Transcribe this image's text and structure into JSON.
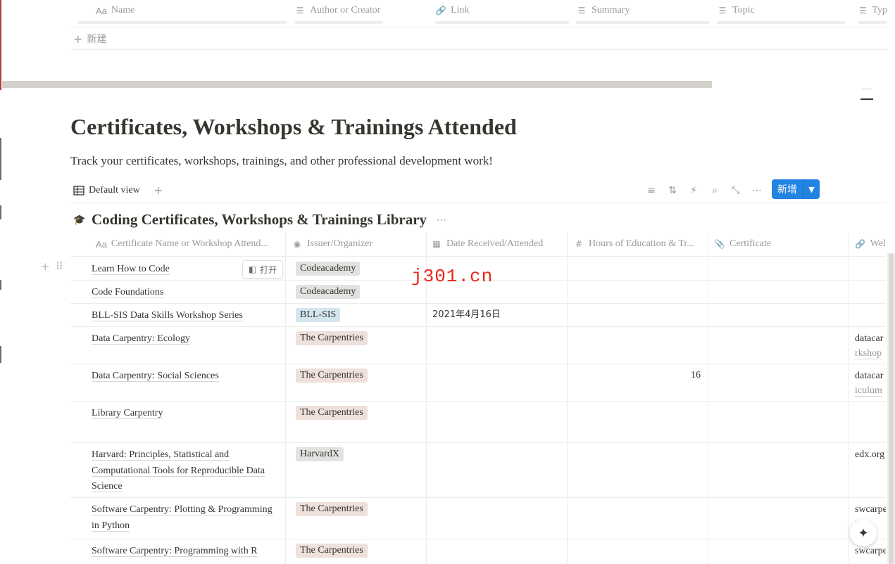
{
  "top_table": {
    "columns": [
      {
        "icon": "text-icon",
        "glyph": "Aa",
        "label": "Name"
      },
      {
        "icon": "list-icon",
        "glyph": "☰",
        "label": "Author or Creator"
      },
      {
        "icon": "link-icon",
        "glyph": "🔗",
        "label": "Link"
      },
      {
        "icon": "list-icon",
        "glyph": "☰",
        "label": "Summary"
      },
      {
        "icon": "list-icon",
        "glyph": "☰",
        "label": "Topic"
      },
      {
        "icon": "list-icon",
        "glyph": "☰",
        "label": "Typ"
      }
    ],
    "new_label": "新建"
  },
  "page": {
    "title": "Certificates, Workshops & Trainings Attended",
    "description": "Track your certificates, workshops, trainings, and other professional development work!"
  },
  "view_bar": {
    "view_label": "Default view",
    "add_glyph": "+",
    "tools": [
      "filter-icon",
      "sort-icon",
      "automation-icon",
      "search-icon",
      "expand-icon",
      "more-icon"
    ],
    "tool_glyphs": [
      "≡",
      "⇅",
      "⚡",
      "⌕",
      "⤡",
      "⋯"
    ],
    "new_button": "新增"
  },
  "database": {
    "icon_glyph": "🎓",
    "title": "Coding Certificates, Workshops & Trainings Library",
    "more_glyph": "⋯"
  },
  "columns": [
    {
      "icon": "text-icon",
      "glyph": "Aa",
      "label": "Certificate Name or Workshop Attend..."
    },
    {
      "icon": "select-icon",
      "glyph": "◉",
      "label": "Issuer/Organizer"
    },
    {
      "icon": "calendar-icon",
      "glyph": "▦",
      "label": "Date Received/Attended"
    },
    {
      "icon": "number-icon",
      "glyph": "#",
      "label": "Hours of Education & Tr..."
    },
    {
      "icon": "attachment-icon",
      "glyph": "📎",
      "label": "Certificate"
    },
    {
      "icon": "link-icon",
      "glyph": "🔗",
      "label": "Wel"
    }
  ],
  "rows": [
    {
      "name": "Learn How to Code",
      "issuer": "Codeacademy",
      "issuer_color": "gray",
      "date": "",
      "hours": "",
      "web1": "",
      "web2": ""
    },
    {
      "name": "Code Foundations",
      "issuer": "Codeacademy",
      "issuer_color": "gray",
      "date": "",
      "hours": "",
      "web1": "",
      "web2": ""
    },
    {
      "name": "BLL-SIS Data Skills Workshop Series",
      "issuer": "BLL-SIS",
      "issuer_color": "blue",
      "date": "2021年4月16日",
      "hours": "",
      "web1": "",
      "web2": ""
    },
    {
      "name": "Data Carpentry: Ecology",
      "issuer": "The Carpentries",
      "issuer_color": "brown",
      "date": "",
      "hours": "",
      "web1": "datacar",
      "web2": "rkshop"
    },
    {
      "name": "Data Carpentry: Social Sciences",
      "issuer": "The Carpentries",
      "issuer_color": "brown",
      "date": "",
      "hours": "16",
      "web1": "datacar",
      "web2": "iculum"
    },
    {
      "name": "Library Carpentry",
      "issuer": "The Carpentries",
      "issuer_color": "brown",
      "date": "",
      "hours": "",
      "web1": "",
      "web2": ""
    },
    {
      "name": "Harvard: Principles, Statistical and Computational Tools for Reproducible Data Science",
      "issuer": "HarvardX",
      "issuer_color": "gray",
      "date": "",
      "hours": "",
      "web1": "edx.org",
      "web2": ""
    },
    {
      "name": "Software Carpentry: Plotting & Programming in Python",
      "issuer": "The Carpentries",
      "issuer_color": "brown",
      "date": "",
      "hours": "",
      "web1": "swcarpe",
      "web2": "t/"
    },
    {
      "name": "Software Carpentry: Programming with R",
      "issuer": "The Carpentries",
      "issuer_color": "brown",
      "date": "",
      "hours": "",
      "web1": "swcarpe",
      "web2": ""
    }
  ],
  "open_button": "打开",
  "watermark": "j301.cn",
  "colors": {
    "accent": "#2383e2",
    "tag_gray": "#e3e2e0",
    "tag_blue": "#d3e5ef",
    "tag_brown": "#eee0da",
    "watermark": "#e8261a"
  }
}
